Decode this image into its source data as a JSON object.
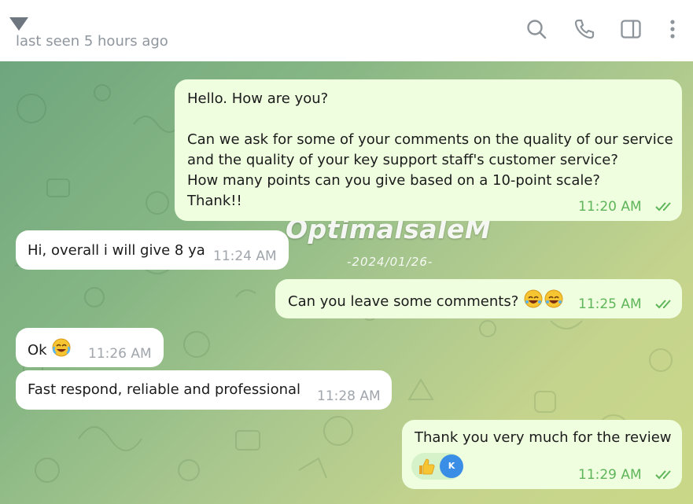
{
  "header": {
    "status": "last seen 5 hours ago",
    "icons": [
      "search-icon",
      "phone-icon",
      "sidebar-toggle-icon",
      "more-icon"
    ]
  },
  "watermark": {
    "brand": "OptimalsaleM",
    "date": "-2024/01/26-"
  },
  "messages": [
    {
      "direction": "outgoing",
      "text": "Hello. How are you?\n\nCan we ask for some of your comments on the quality of our service\nand the quality of your key support staff's customer service?\nHow many points can you give based on a 10-point scale?\nThank!!",
      "time": "11:20 AM",
      "read": true
    },
    {
      "direction": "incoming",
      "text": "Hi, overall i will give 8 ya",
      "time": "11:24 AM"
    },
    {
      "direction": "outgoing",
      "text": "Can you leave some comments? ",
      "emojis": [
        "rofl",
        "rofl"
      ],
      "time": "11:25 AM",
      "read": true
    },
    {
      "direction": "incoming",
      "text": "Ok ",
      "emojis": [
        "joy"
      ],
      "time": "11:26 AM"
    },
    {
      "direction": "incoming",
      "text": "Fast respond, reliable and professional",
      "time": "11:28 AM"
    },
    {
      "direction": "outgoing",
      "text": "Thank you very much for the review",
      "time": "11:29 AM",
      "read": true,
      "reaction": {
        "emoji": "thumbs-up",
        "avatar_initial": "K"
      }
    }
  ],
  "colors": {
    "outgoing_bubble": "#eefedf",
    "incoming_bubble": "#ffffff",
    "outgoing_time": "#5fb55a",
    "incoming_time": "#a0a6ac",
    "avatar": "#3a8ee6"
  }
}
